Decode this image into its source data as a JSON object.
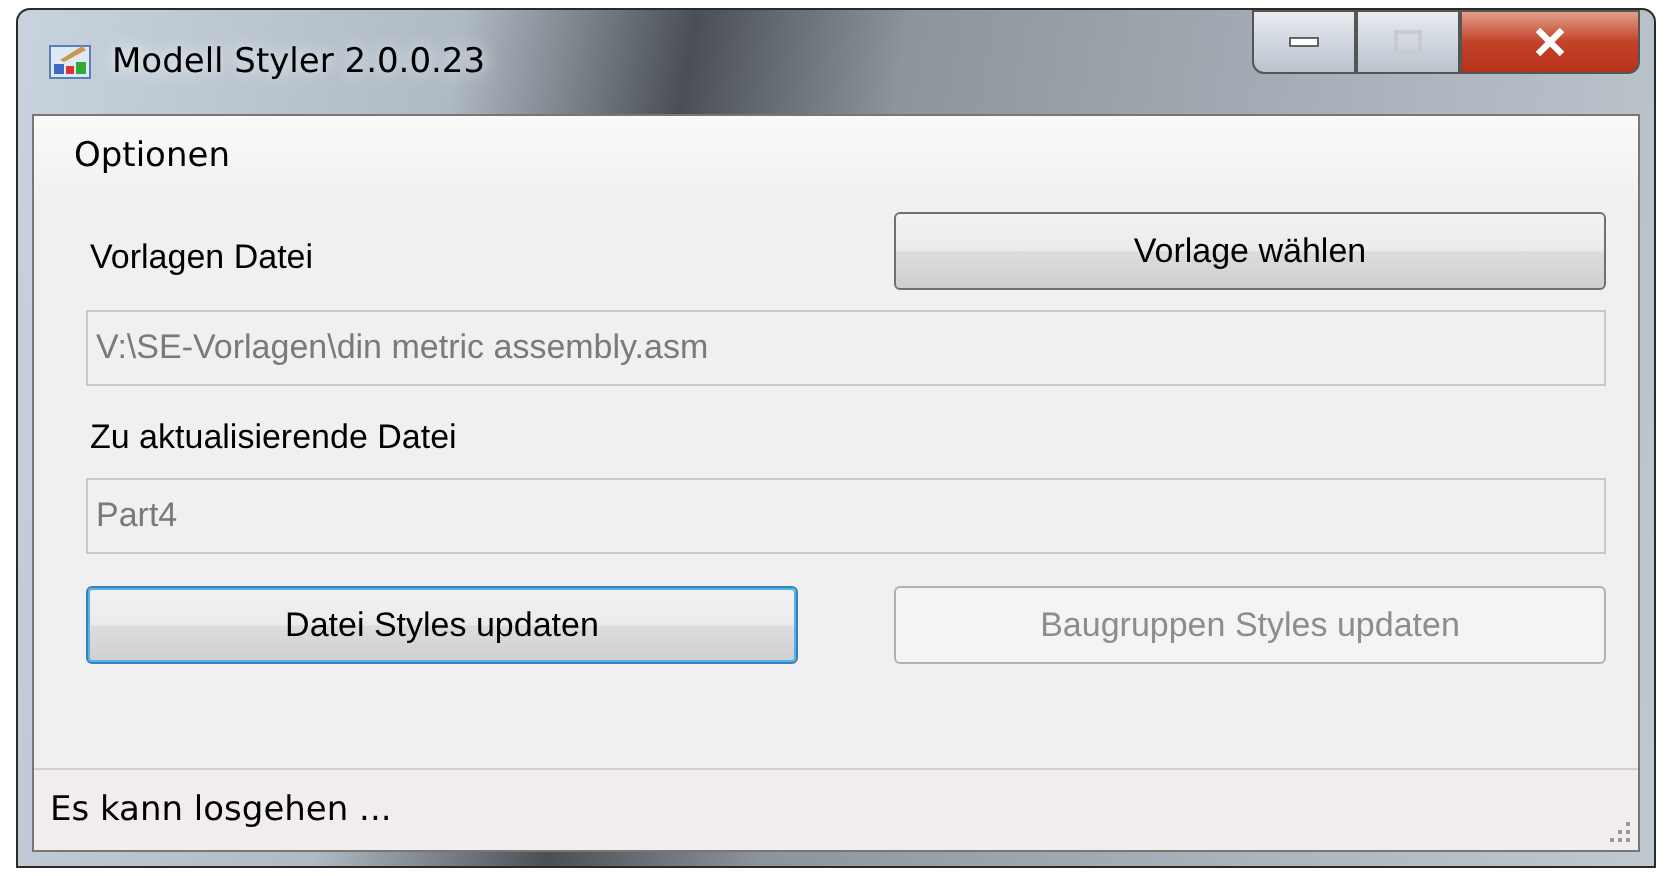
{
  "window": {
    "title": "Modell Styler 2.0.0.23",
    "maximize_disabled": true
  },
  "menu": [
    {
      "label": "Optionen"
    }
  ],
  "template": {
    "label": "Vorlagen Datei",
    "button": {
      "label": "Vorlage wählen",
      "disabled": false,
      "focused": false
    },
    "field": {
      "value": "V:\\SE-Vorlagen\\din metric assembly.asm",
      "disabled": true
    }
  },
  "target": {
    "label": "Zu aktualisierende Datei",
    "field": {
      "value": "Part4",
      "disabled": true
    }
  },
  "buttons": [
    {
      "label": "Datei Styles updaten",
      "disabled": false,
      "focused": true
    },
    {
      "label": "Baugruppen Styles updaten",
      "disabled": true,
      "focused": false
    }
  ],
  "status_bar": {
    "text": "Es kann losgehen ..."
  }
}
